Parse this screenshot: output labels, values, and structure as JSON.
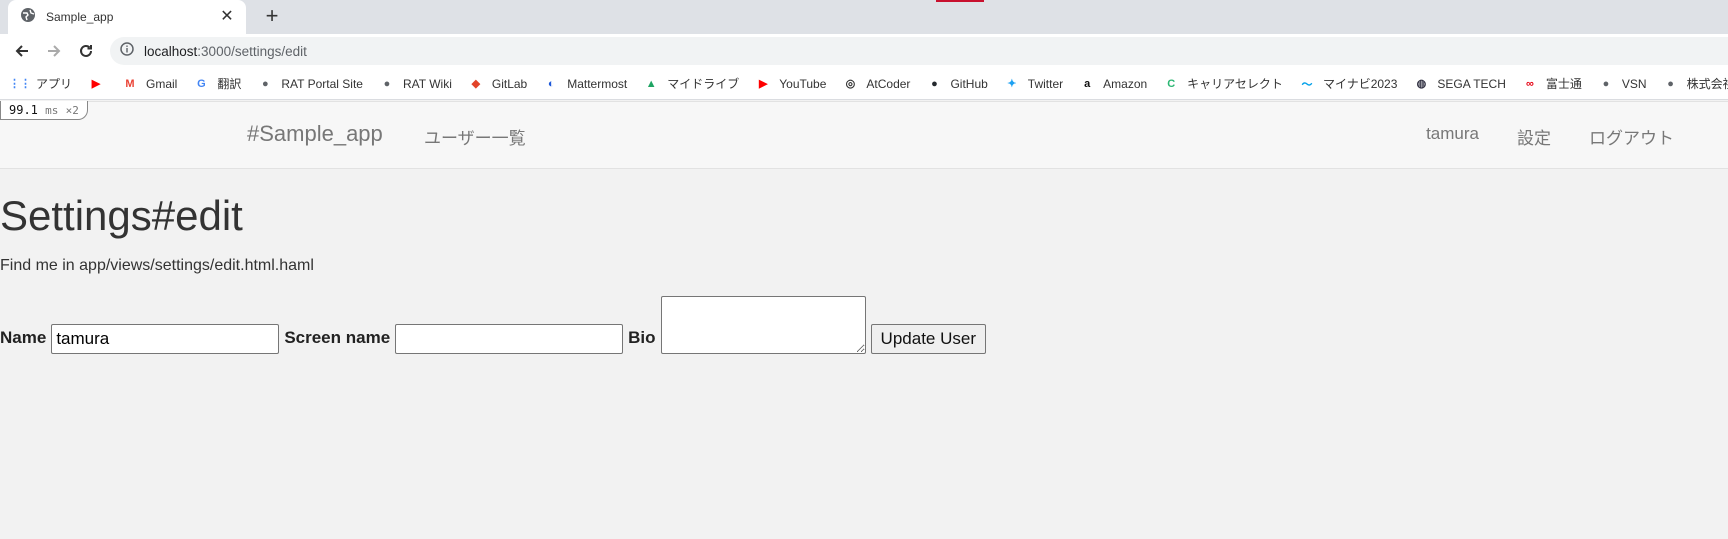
{
  "browser": {
    "tab_title": "Sample_app",
    "url_host": "localhost",
    "url_path": ":3000/settings/edit",
    "bookmarks": [
      {
        "label": "アプリ",
        "icon": "apps-grid-icon"
      },
      {
        "label": "",
        "icon": "youtube-icon"
      },
      {
        "label": "Gmail",
        "icon": "gmail-icon"
      },
      {
        "label": "翻訳",
        "icon": "translate-icon"
      },
      {
        "label": "RAT Portal Site",
        "icon": "globe-icon"
      },
      {
        "label": "RAT Wiki",
        "icon": "globe-icon"
      },
      {
        "label": "GitLab",
        "icon": "gitlab-icon"
      },
      {
        "label": "Mattermost",
        "icon": "mattermost-icon"
      },
      {
        "label": "マイドライブ",
        "icon": "drive-icon"
      },
      {
        "label": "YouTube",
        "icon": "youtube-icon"
      },
      {
        "label": "AtCoder",
        "icon": "atcoder-icon"
      },
      {
        "label": "GitHub",
        "icon": "github-icon"
      },
      {
        "label": "Twitter",
        "icon": "twitter-icon"
      },
      {
        "label": "Amazon",
        "icon": "amazon-icon"
      },
      {
        "label": "キャリアセレクト",
        "icon": "career-select-icon"
      },
      {
        "label": "マイナビ2023",
        "icon": "mynavi-icon"
      },
      {
        "label": "SEGA TECH",
        "icon": "sega-icon"
      },
      {
        "label": "富士通",
        "icon": "fujitsu-icon"
      },
      {
        "label": "VSN",
        "icon": "globe-icon"
      },
      {
        "label": "株式会社コーエーテク…",
        "icon": "globe-icon"
      }
    ]
  },
  "profiler": {
    "value": "99.1",
    "unit": "ms",
    "count": "×2"
  },
  "navbar": {
    "brand": "#Sample_app",
    "users_link": "ユーザー一覧",
    "username": "tamura",
    "settings_link": "設定",
    "logout_link": "ログアウト"
  },
  "page": {
    "heading": "Settings#edit",
    "hint": "Find me in app/views/settings/edit.html.haml"
  },
  "form": {
    "name_label": "Name",
    "name_value": "tamura",
    "screen_name_label": "Screen name",
    "screen_name_value": "",
    "bio_label": "Bio",
    "bio_value": "",
    "submit_label": "Update User"
  }
}
